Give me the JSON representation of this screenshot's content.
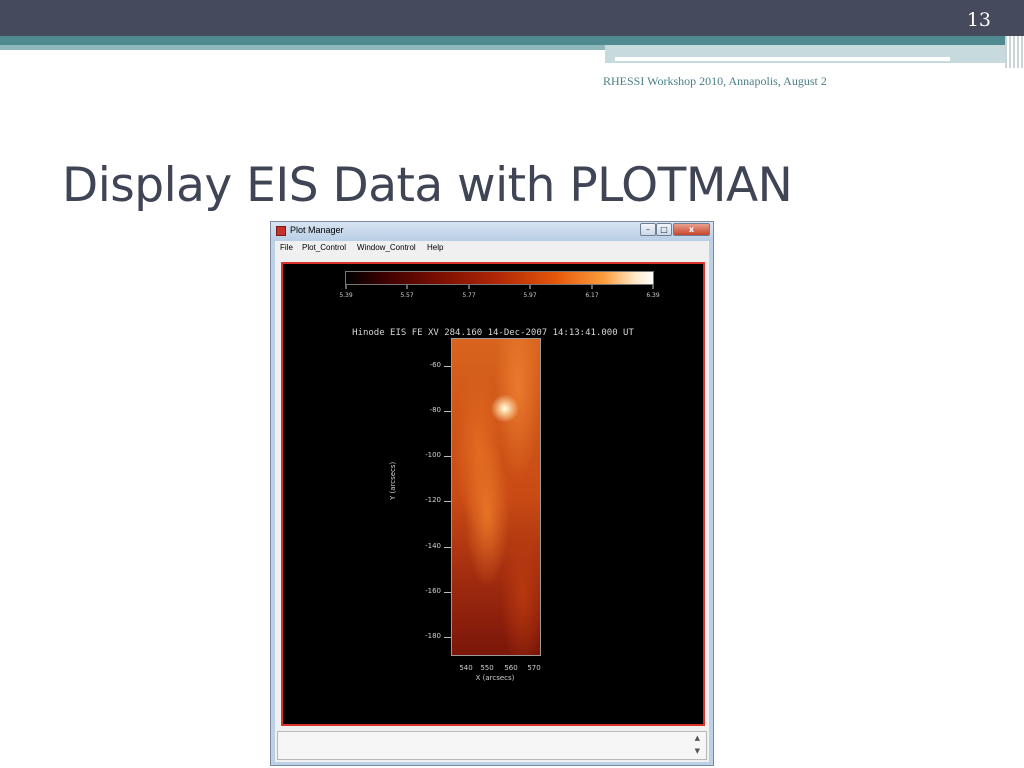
{
  "slide": {
    "page_number": "13",
    "footer": "RHESSI Workshop 2010, Annapolis, August 2",
    "title": "Display EIS Data with PLOTMAN"
  },
  "window": {
    "title": "Plot Manager",
    "buttons": {
      "minimize": "–",
      "maximize": "□",
      "close": "x"
    },
    "menu": [
      "File",
      "Plot_Control",
      "Window_Control",
      "Help"
    ]
  },
  "plot": {
    "title": "Hinode EIS FE XV 284.160 14-Dec-2007 14:13:41.000 UT",
    "colorbar_labels": [
      "5.39",
      "5.57",
      "5.77",
      "5.97",
      "6.17",
      "6.39"
    ],
    "y_axis_title": "Y (arcsecs)",
    "x_axis_title": "X (arcsecs)",
    "y_ticks": [
      "-60",
      "-80",
      "-100",
      "-120",
      "-140",
      "-160",
      "-180"
    ],
    "x_ticks": [
      "540",
      "550",
      "560",
      "570"
    ]
  },
  "colors": {
    "accent_dark": "#454a5c",
    "accent_teal": "#4f8a91",
    "plot_border": "#d8332c"
  }
}
